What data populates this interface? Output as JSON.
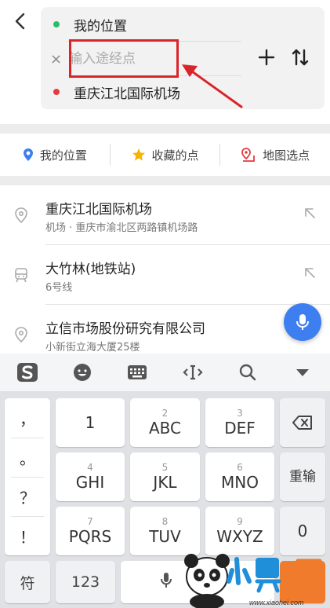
{
  "route": {
    "start": "我的位置",
    "waypoint_placeholder": "输入途经点",
    "end": "重庆江北国际机场",
    "colors": {
      "start_dot": "#2dbb6a",
      "end_dot": "#e8393e",
      "highlight_box": "#d9252a"
    }
  },
  "quick_tabs": [
    {
      "label": "我的位置",
      "icon": "location-pin-icon"
    },
    {
      "label": "收藏的点",
      "icon": "star-icon"
    },
    {
      "label": "地图选点",
      "icon": "map-pick-icon"
    }
  ],
  "results": [
    {
      "title": "重庆江北国际机场",
      "subtitle": "机场 · 重庆市渝北区两路镇机场路",
      "icon": "location-pin-icon"
    },
    {
      "title": "大竹林(地铁站)",
      "subtitle": "6号线",
      "icon": "subway-icon"
    },
    {
      "title": "立信市场股份研究有限公司",
      "subtitle": "小新街立海大厦25楼",
      "icon": "location-pin-icon"
    }
  ],
  "keyboard": {
    "punctuation": [
      "，",
      "。",
      "？",
      "！"
    ],
    "keys": [
      {
        "num": "",
        "label": "1"
      },
      {
        "num": "2",
        "label": "ABC"
      },
      {
        "num": "3",
        "label": "DEF"
      },
      {
        "num": "4",
        "label": "GHI"
      },
      {
        "num": "5",
        "label": "JKL"
      },
      {
        "num": "6",
        "label": "MNO"
      },
      {
        "num": "7",
        "label": "PQRS"
      },
      {
        "num": "8",
        "label": "TUV"
      },
      {
        "num": "9",
        "label": "WXYZ"
      }
    ],
    "reenter": "重输",
    "zero": "0",
    "symbol": "符",
    "numeric": "123"
  },
  "watermark": {
    "brand": "小黑游戏",
    "url": "www.xiaohei.com"
  }
}
